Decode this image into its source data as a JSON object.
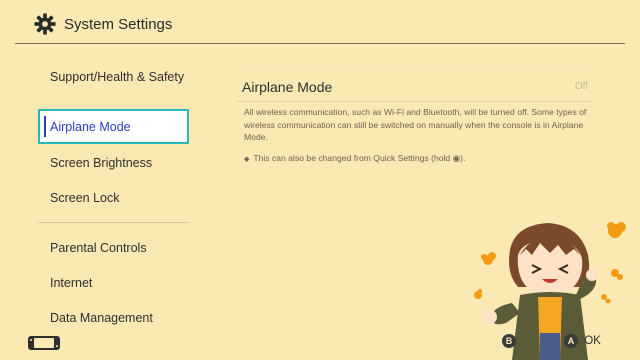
{
  "header": {
    "title": "System Settings",
    "icon": "gear-icon"
  },
  "sidebar": {
    "items": [
      {
        "label": "Support/Health & Safety"
      },
      {
        "label": "Airplane Mode",
        "selected": true
      },
      {
        "label": "Screen Brightness"
      },
      {
        "label": "Screen Lock"
      },
      {
        "label": "Parental Controls"
      },
      {
        "label": "Internet"
      },
      {
        "label": "Data Management"
      }
    ]
  },
  "main": {
    "setting_label": "Airplane Mode",
    "setting_value": "Off",
    "description": "All wireless communication, such as Wi-Fi and Bluetooth, will be turned off. Some types of wireless communication can still be switched on manually when the console is in Airplane Mode.",
    "note": "This can also be changed from Quick Settings (hold ◉)."
  },
  "footer": {
    "back_button": "B",
    "ok_button": "A",
    "ok_label": "OK"
  },
  "colors": {
    "background": "#fbe9b4",
    "selection_border": "#27b9b7",
    "selection_text": "#2b3dc9"
  }
}
